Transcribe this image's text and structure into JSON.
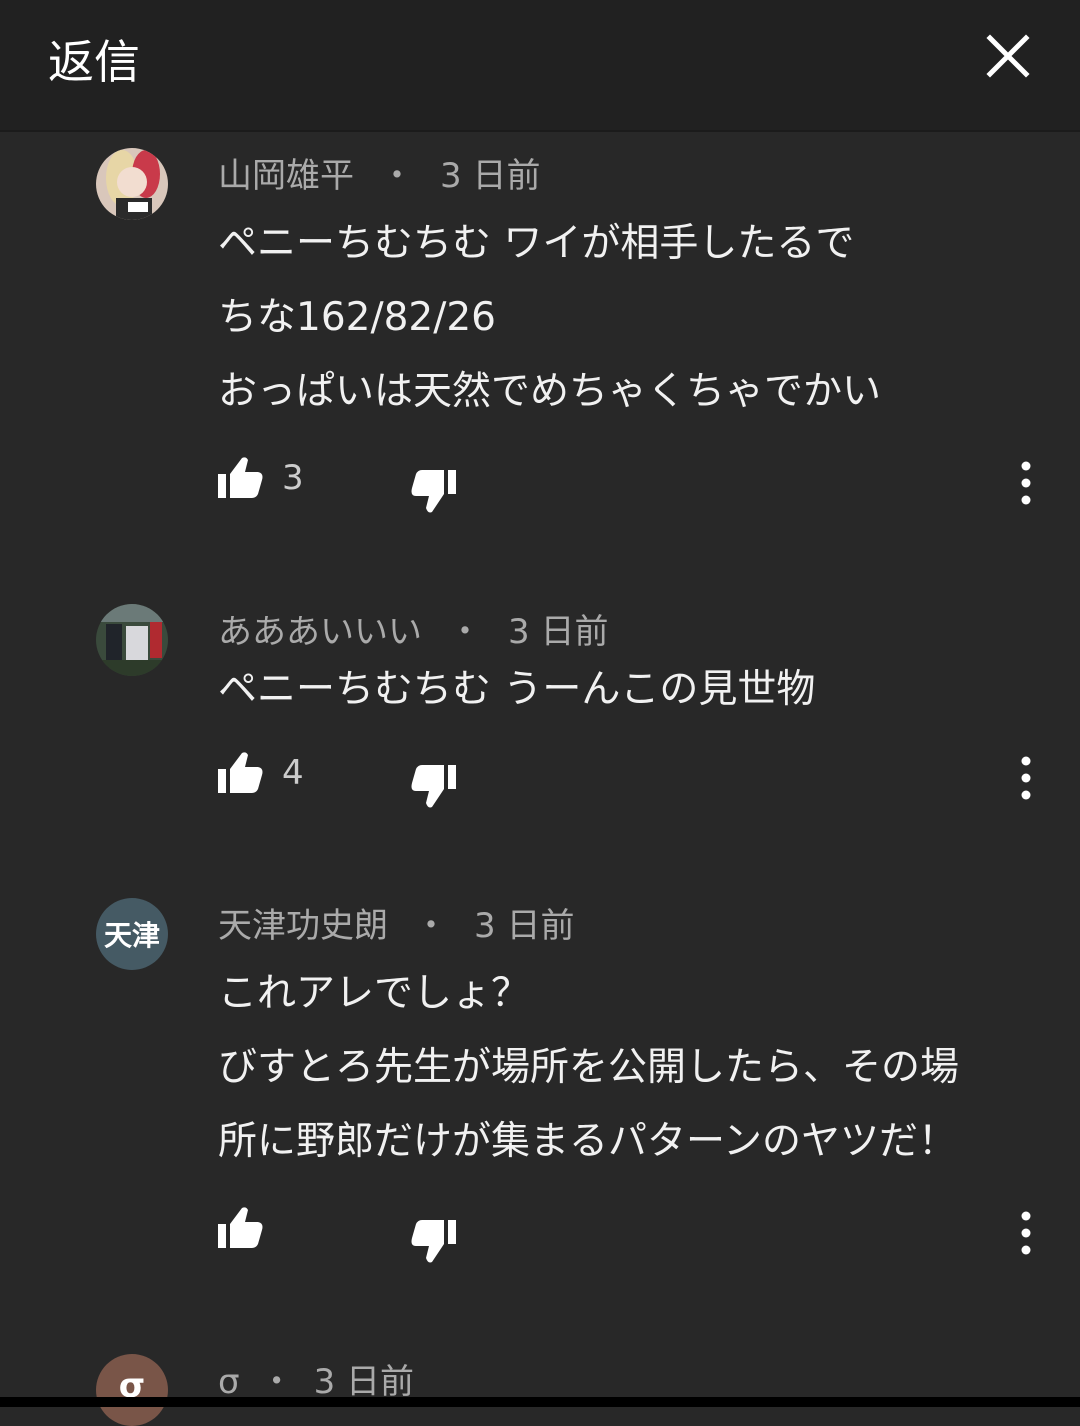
{
  "header": {
    "title": "返信"
  },
  "comments": [
    {
      "author": "山岡雄平",
      "time": "3 日前",
      "lines": [
        "ペニーちむちむ ワイが相手したるで",
        "ちな162/82/26",
        "おっぱいは天然でめちゃくちゃでかい"
      ],
      "likes": "3"
    },
    {
      "author": "あああいいい",
      "time": "3 日前",
      "lines": [
        "ペニーちむちむ うーんこの見世物"
      ],
      "likes": "4"
    },
    {
      "author": "天津功史朗",
      "time": "3 日前",
      "avatar_text": "天津",
      "lines": [
        "これアレでしょ？",
        "びすとろ先生が場所を公開したら、その場",
        "所に野郎だけが集まるパターンのヤツだ！"
      ],
      "likes": ""
    },
    {
      "author": "σ",
      "time": "3 日前",
      "avatar_text": "σ"
    }
  ],
  "colors": {
    "background": "#282828",
    "header": "#212121",
    "avatar_text_bg": "#455a64",
    "avatar_sigma_bg": "#795548"
  },
  "icons": [
    "close-icon",
    "thumb-up-icon",
    "thumb-down-icon",
    "more-vert-icon"
  ]
}
